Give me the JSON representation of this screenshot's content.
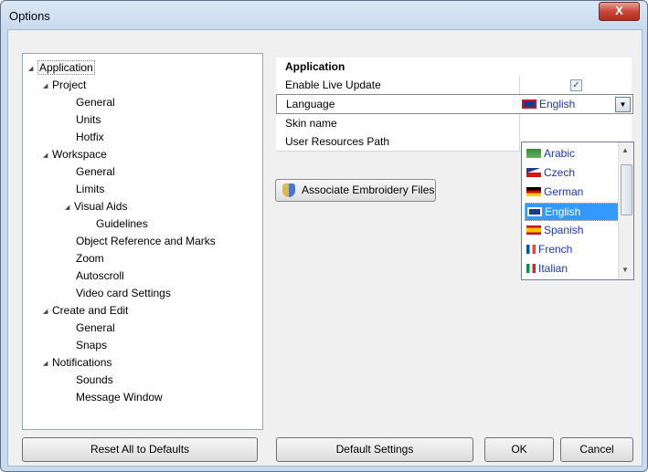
{
  "window": {
    "title": "Options",
    "close_glyph": "X"
  },
  "tree": {
    "items": [
      {
        "label": "Application",
        "toggle": "◢",
        "selected": true
      },
      {
        "label": "Project",
        "toggle": "◢"
      },
      {
        "label": "General"
      },
      {
        "label": "Units"
      },
      {
        "label": "Hotfix"
      },
      {
        "label": "Workspace",
        "toggle": "◢"
      },
      {
        "label": "General"
      },
      {
        "label": "Limits"
      },
      {
        "label": "Visual Aids",
        "toggle": "◢"
      },
      {
        "label": "Guidelines"
      },
      {
        "label": "Object Reference and Marks"
      },
      {
        "label": "Zoom"
      },
      {
        "label": "Autoscroll"
      },
      {
        "label": "Video card Settings"
      },
      {
        "label": "Create and Edit",
        "toggle": "◢"
      },
      {
        "label": "General"
      },
      {
        "label": "Snaps"
      },
      {
        "label": "Notifications",
        "toggle": "◢"
      },
      {
        "label": "Sounds"
      },
      {
        "label": "Message Window"
      }
    ]
  },
  "properties": {
    "header": "Application",
    "rows": [
      {
        "name": "Enable Live Update",
        "value": "checked"
      },
      {
        "name": "Language",
        "value": "English"
      },
      {
        "name": "Skin name",
        "value": ""
      },
      {
        "name": "User Resources Path",
        "value": ""
      }
    ],
    "checkbox_glyph": "✓",
    "dropdown_arrow": "▼"
  },
  "associate_button": "Associate Embroidery Files",
  "language_dropdown": {
    "options": [
      "Arabic",
      "Czech",
      "German",
      "English",
      "Spanish",
      "French",
      "Italian"
    ],
    "selected": "English",
    "scroll_up": "▲",
    "scroll_down": "▼"
  },
  "buttons": {
    "reset": "Reset All to Defaults",
    "default_settings": "Default Settings",
    "ok": "OK",
    "cancel": "Cancel"
  },
  "colors": {
    "selection": "#3399ff",
    "dropdown_text": "#1f33b2",
    "close_button": "#c8483a"
  }
}
